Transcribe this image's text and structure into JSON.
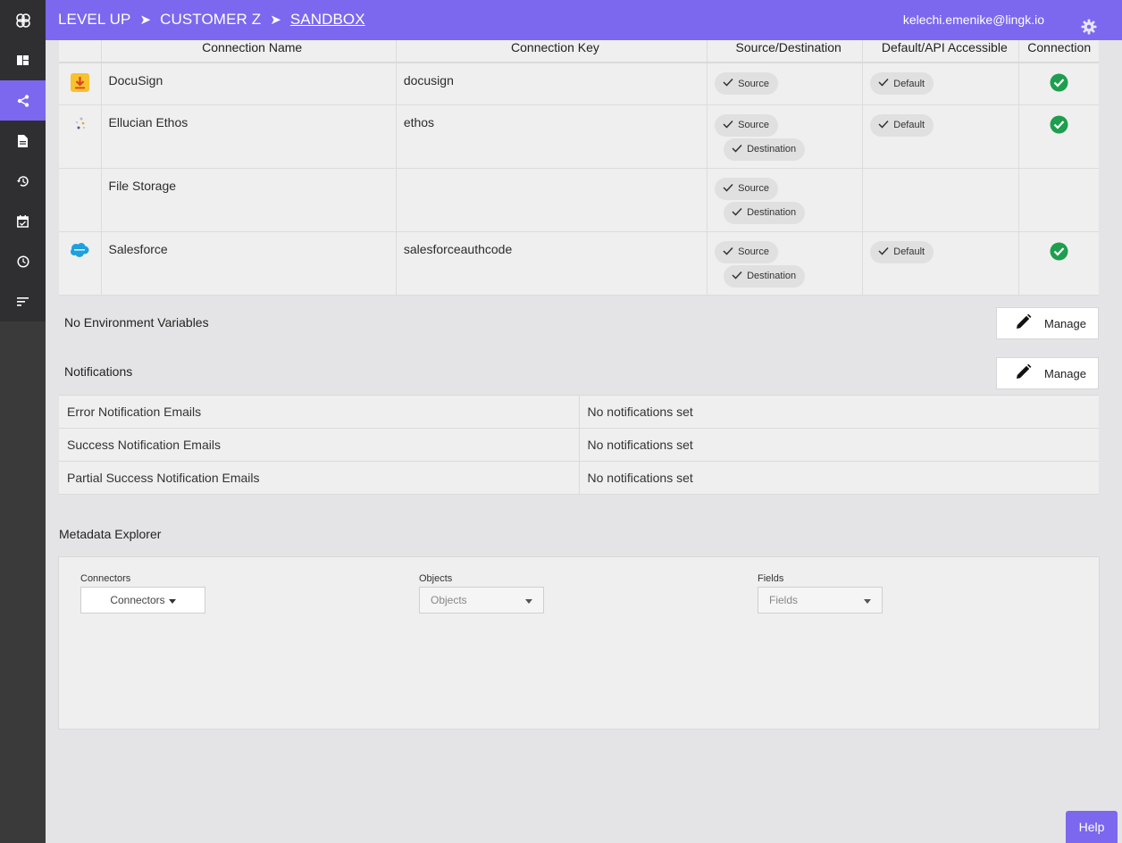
{
  "header": {
    "breadcrumbs": [
      "LEVEL UP",
      "CUSTOMER Z",
      "SANDBOX"
    ],
    "separator": "➤",
    "user_email": "kelechi.emenike@lingk.io",
    "brand_color": "#7b68ee"
  },
  "sidebar": {
    "items": [
      {
        "icon": "lingk-logo-icon"
      },
      {
        "icon": "dashboard-icon"
      },
      {
        "icon": "share-icon",
        "active": true
      },
      {
        "icon": "document-icon"
      },
      {
        "icon": "history-icon"
      },
      {
        "icon": "calendar-icon"
      },
      {
        "icon": "clock-icon"
      },
      {
        "icon": "sort-icon"
      }
    ]
  },
  "connections": {
    "headers": [
      "Connection Name",
      "Connection Key",
      "Source/Destination",
      "Default/API Accessible",
      "Connection"
    ],
    "rows": [
      {
        "name": "DocuSign",
        "key": "docusign",
        "roles": [
          "Source"
        ],
        "default": "Default",
        "connected": true
      },
      {
        "name": "Ellucian Ethos",
        "key": "ethos",
        "roles": [
          "Source",
          "Destination"
        ],
        "default": "Default",
        "connected": true
      },
      {
        "name": "File Storage",
        "key": "",
        "roles": [
          "Source",
          "Destination"
        ],
        "default": "",
        "connected": false
      },
      {
        "name": "Salesforce",
        "key": "salesforceauthcode",
        "roles": [
          "Source",
          "Destination"
        ],
        "default": "Default",
        "connected": true
      }
    ]
  },
  "env": {
    "label": "No Environment Variables",
    "manage_label": "Manage"
  },
  "notifications": {
    "label": "Notifications",
    "manage_label": "Manage",
    "rows": [
      {
        "type": "Error Notification Emails",
        "value": "No notifications set"
      },
      {
        "type": "Success Notification Emails",
        "value": "No notifications set"
      },
      {
        "type": "Partial Success Notification Emails",
        "value": "No notifications set"
      }
    ]
  },
  "metadata": {
    "title": "Metadata Explorer",
    "connectors": {
      "label": "Connectors",
      "value": "Connectors"
    },
    "objects": {
      "label": "Objects",
      "value": "Objects"
    },
    "fields": {
      "label": "Fields",
      "value": "Fields"
    }
  },
  "help_label": "Help"
}
